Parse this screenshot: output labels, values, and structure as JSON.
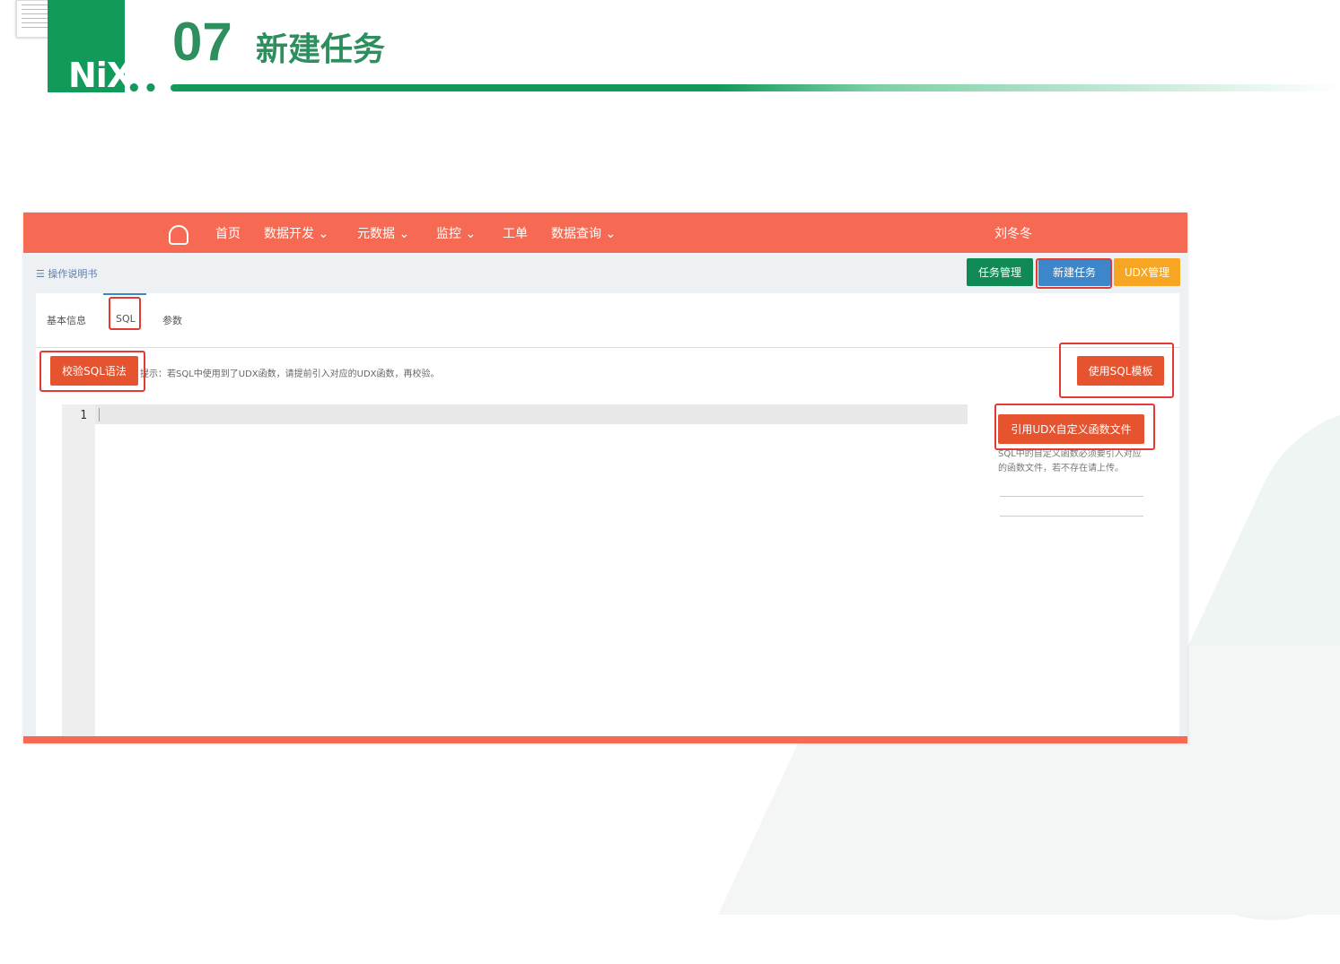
{
  "slide": {
    "logo_text": "NiX",
    "number": "07",
    "title": "新建任务"
  },
  "navbar": {
    "items": [
      {
        "label": "首页"
      },
      {
        "label": "数据开发 ⌄"
      },
      {
        "label": "元数据 ⌄"
      },
      {
        "label": "监控 ⌄"
      },
      {
        "label": "工单"
      },
      {
        "label": "数据查询 ⌄"
      }
    ],
    "user": "刘冬冬"
  },
  "subbar": {
    "manual": "操作说明书",
    "buttons": {
      "task_manage": "任务管理",
      "new_task": "新建任务",
      "udx_manage": "UDX管理"
    }
  },
  "tabs": [
    {
      "label": "基本信息"
    },
    {
      "label": "SQL"
    },
    {
      "label": "参数"
    }
  ],
  "actions": {
    "validate_sql": "校验SQL语法",
    "hint": "提示：若SQL中使用到了UDX函数，请提前引入对应的UDX函数，再校验。",
    "use_template": "使用SQL模板",
    "reference_udx": "引用UDX自定义函数文件",
    "udx_note": "SQL中的自定义函数必须要引入对应的函数文件，若不存在请上传。"
  },
  "editor": {
    "line_numbers": [
      "1"
    ]
  },
  "colors": {
    "brand_green": "#129a5a",
    "navbar": "#f66a53",
    "highlight": "#e53935"
  }
}
